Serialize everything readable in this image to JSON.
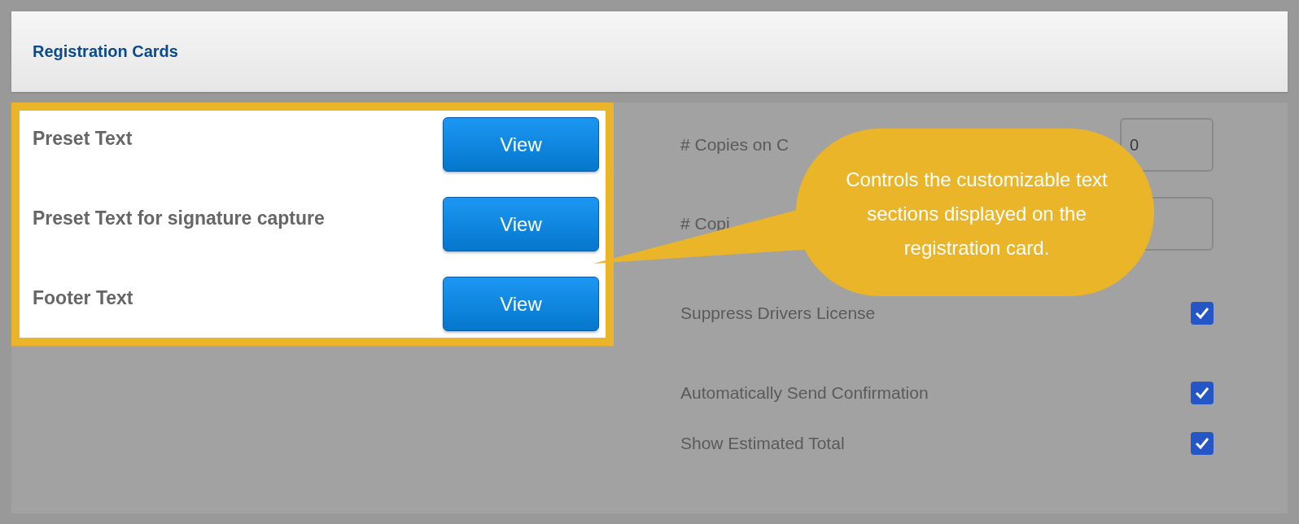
{
  "header": {
    "title": "Registration Cards"
  },
  "highlighted_section": {
    "rows": [
      {
        "label": "Preset Text",
        "button": "View"
      },
      {
        "label": "Preset Text for signature capture",
        "button": "View"
      },
      {
        "label": "Footer Text",
        "button": "View"
      }
    ]
  },
  "settings": [
    {
      "kind": "number",
      "label": "# Copies on C",
      "value": "0"
    },
    {
      "kind": "number",
      "label": "# Copi"
    },
    {
      "kind": "checkbox",
      "label": "Suppress Drivers License",
      "checked": true
    },
    {
      "kind": "checkbox",
      "label": "Automatically Send Confirmation",
      "checked": true
    },
    {
      "kind": "checkbox",
      "label": "Show Estimated Total",
      "checked": true
    }
  ],
  "callout": {
    "text": "Controls the customizable text sections displayed on the registration card."
  }
}
